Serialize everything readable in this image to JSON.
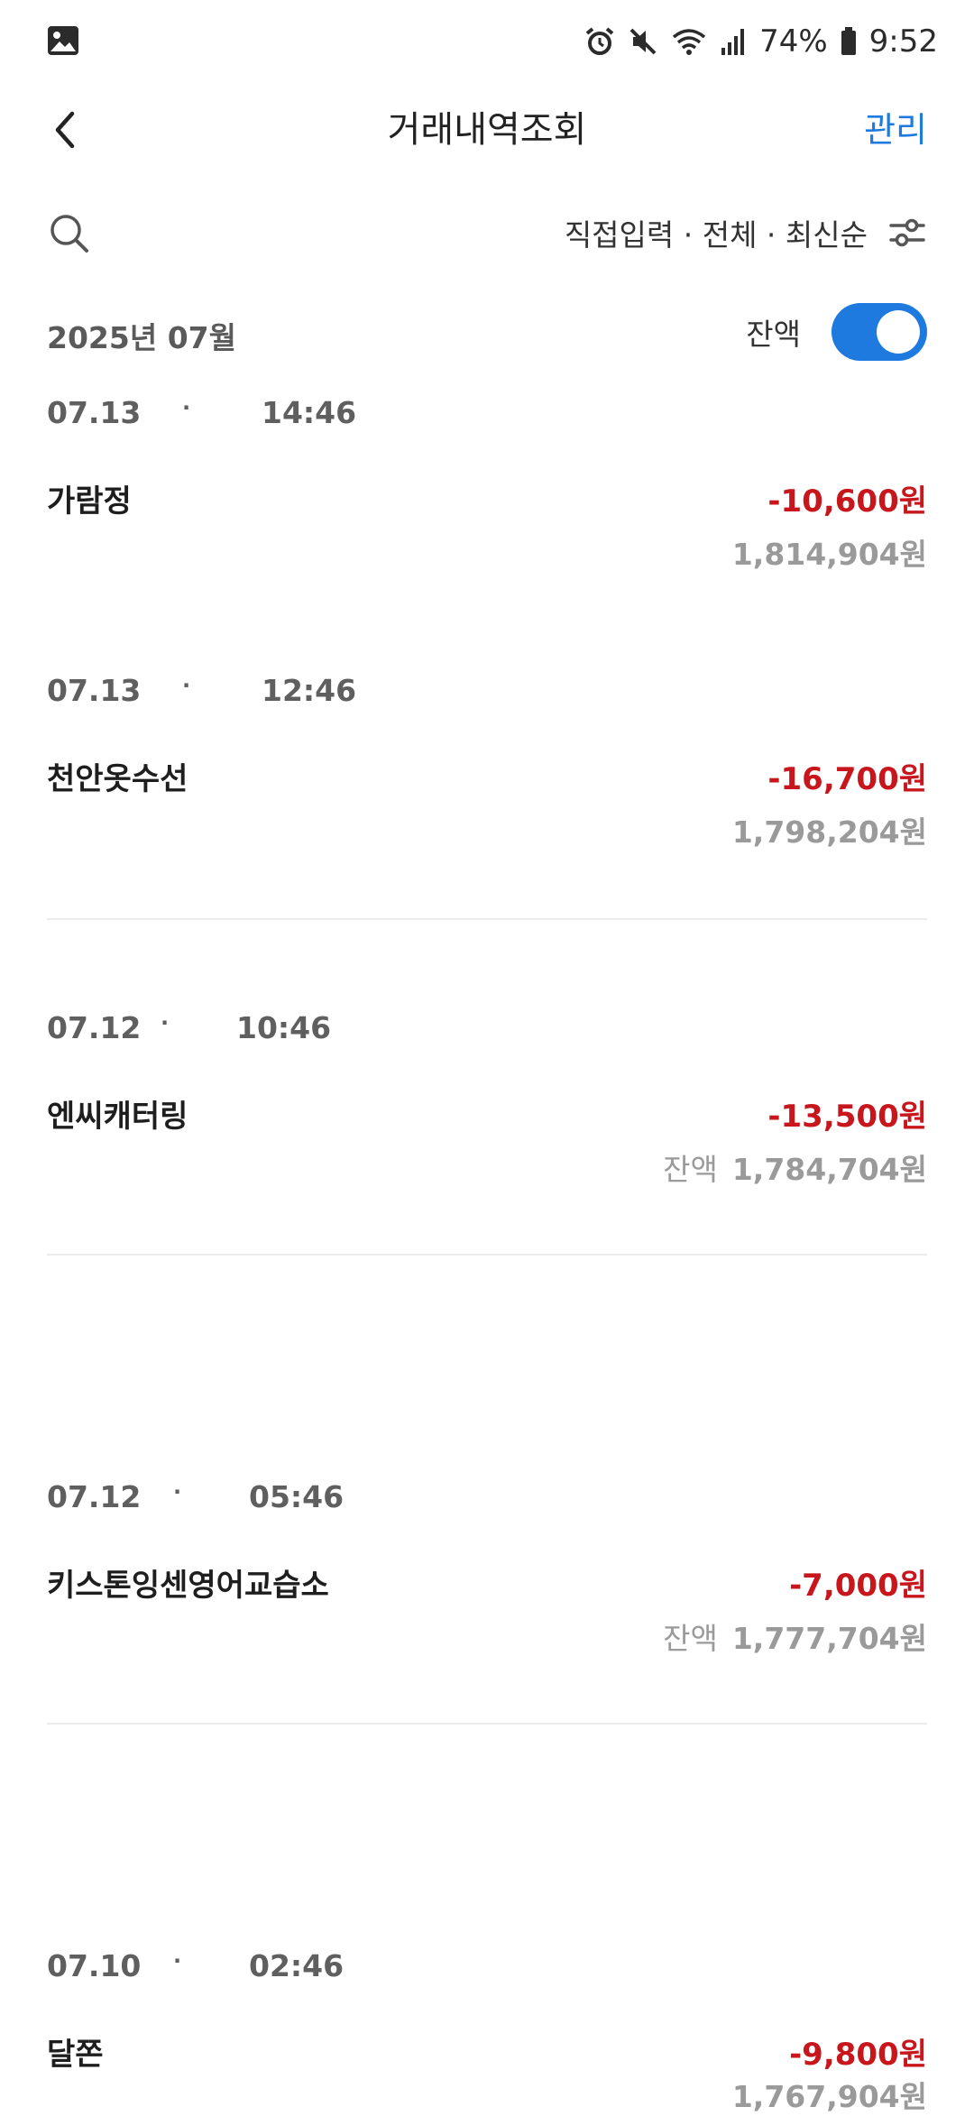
{
  "status_bar": {
    "left_icon": "gallery-notification-icon",
    "icons": [
      "alarm-icon",
      "mute-icon",
      "wifi-icon",
      "signal-icon"
    ],
    "battery_text": "74%",
    "battery_icon": "battery-icon",
    "time": "9:52"
  },
  "app_bar": {
    "back_icon": "chevron-left-icon",
    "title": "거래내역조회",
    "manage_label": "관리",
    "accent_color": "#1f7ae0"
  },
  "filter": {
    "search_icon": "search-icon",
    "summary": "직접입력 · 전체 · 최신순",
    "filter_icon": "sliders-icon"
  },
  "month": {
    "label": "2025년 07월",
    "balance_toggle_label": "잔액",
    "balance_toggle_on": true
  },
  "amount_color": "#c8161d",
  "transactions": [
    {
      "date": "07.13",
      "separator": "·",
      "time": "14:46",
      "merchant": "가람정",
      "amount": "-10,600원",
      "balance_prefix": "",
      "balance": "1,814,904원"
    },
    {
      "date": "07.13",
      "separator": "·",
      "time": "12:46",
      "merchant": "천안옷수선",
      "amount": "-16,700원",
      "balance_prefix": "",
      "balance": "1,798,204원"
    },
    {
      "date": "07.12",
      "separator": "·",
      "time": "10:46",
      "merchant": "엔씨캐터링",
      "amount": "-13,500원",
      "balance_prefix": "잔액",
      "balance": "1,784,704원"
    },
    {
      "date": "07.12",
      "separator": "·",
      "time": "05:46",
      "merchant": "키스톤잉센영어교습소",
      "amount": "-7,000원",
      "balance_prefix": "잔액",
      "balance": "1,777,704원"
    },
    {
      "date": "07.10",
      "separator": "·",
      "time": "02:46",
      "merchant": "달쫀",
      "amount": "-9,800원",
      "balance_prefix": "",
      "balance": "1,767,904원"
    }
  ]
}
